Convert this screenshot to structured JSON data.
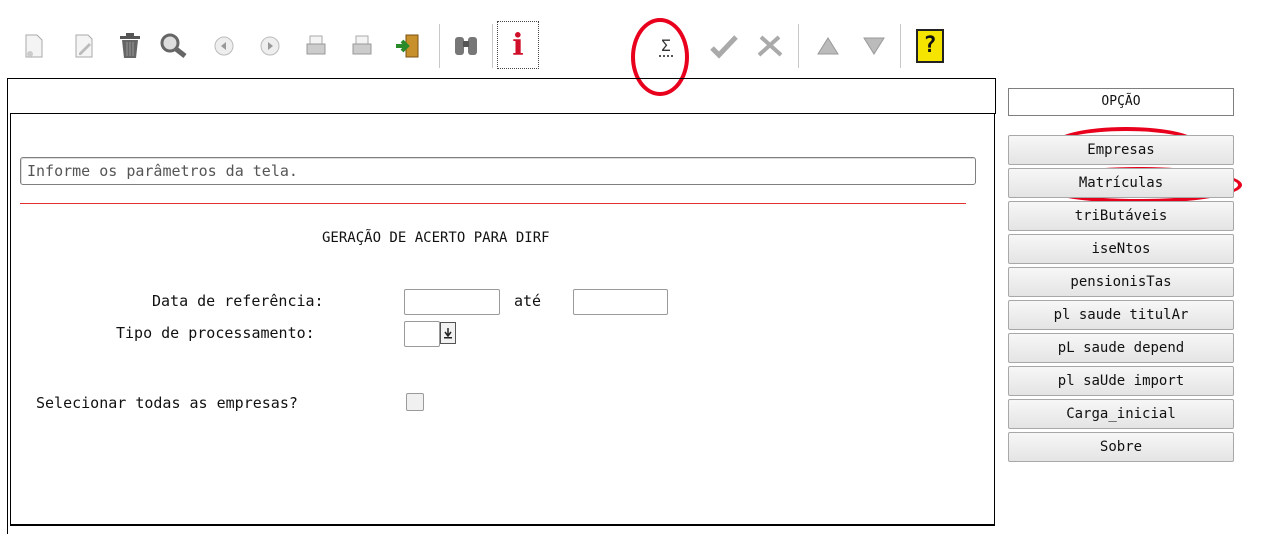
{
  "toolbar": {
    "buttons": [
      "new-doc-icon",
      "edit-icon",
      "trash-icon",
      "search-icon",
      "previous-icon",
      "next-icon",
      "print-icon",
      "print-alt-icon",
      "exit-door-icon",
      "binoculars-icon",
      "info-icon",
      "sum-icon",
      "check-icon",
      "tools-icon",
      "up-icon",
      "down-icon",
      "help-icon"
    ],
    "info_label": "i",
    "sum_label": "Σ",
    "help_label": "?"
  },
  "form": {
    "message_placeholder": "Informe os parâmetros da tela.",
    "title": "GERAÇÃO DE ACERTO PARA DIRF",
    "data_referencia_label": "Data de referência:",
    "ate_label": "até",
    "tipo_processamento_label": "Tipo de processamento:",
    "selecionar_label": "Selecionar todas as empresas?",
    "data_referencia_value": "",
    "ate_value": "",
    "tipo_processamento_value": ""
  },
  "side_panel": {
    "header": "OPÇÃO",
    "buttons": [
      "Empresas",
      "Matrículas",
      "triButáveis",
      "iseNtos",
      "pensionisTas",
      "pl saude titulAr",
      "pL saude depend",
      "pl saUde import",
      "Carga_inicial",
      "Sobre"
    ]
  },
  "colors": {
    "annotation_red": "#e8001c",
    "separator_line": "#e03030"
  }
}
